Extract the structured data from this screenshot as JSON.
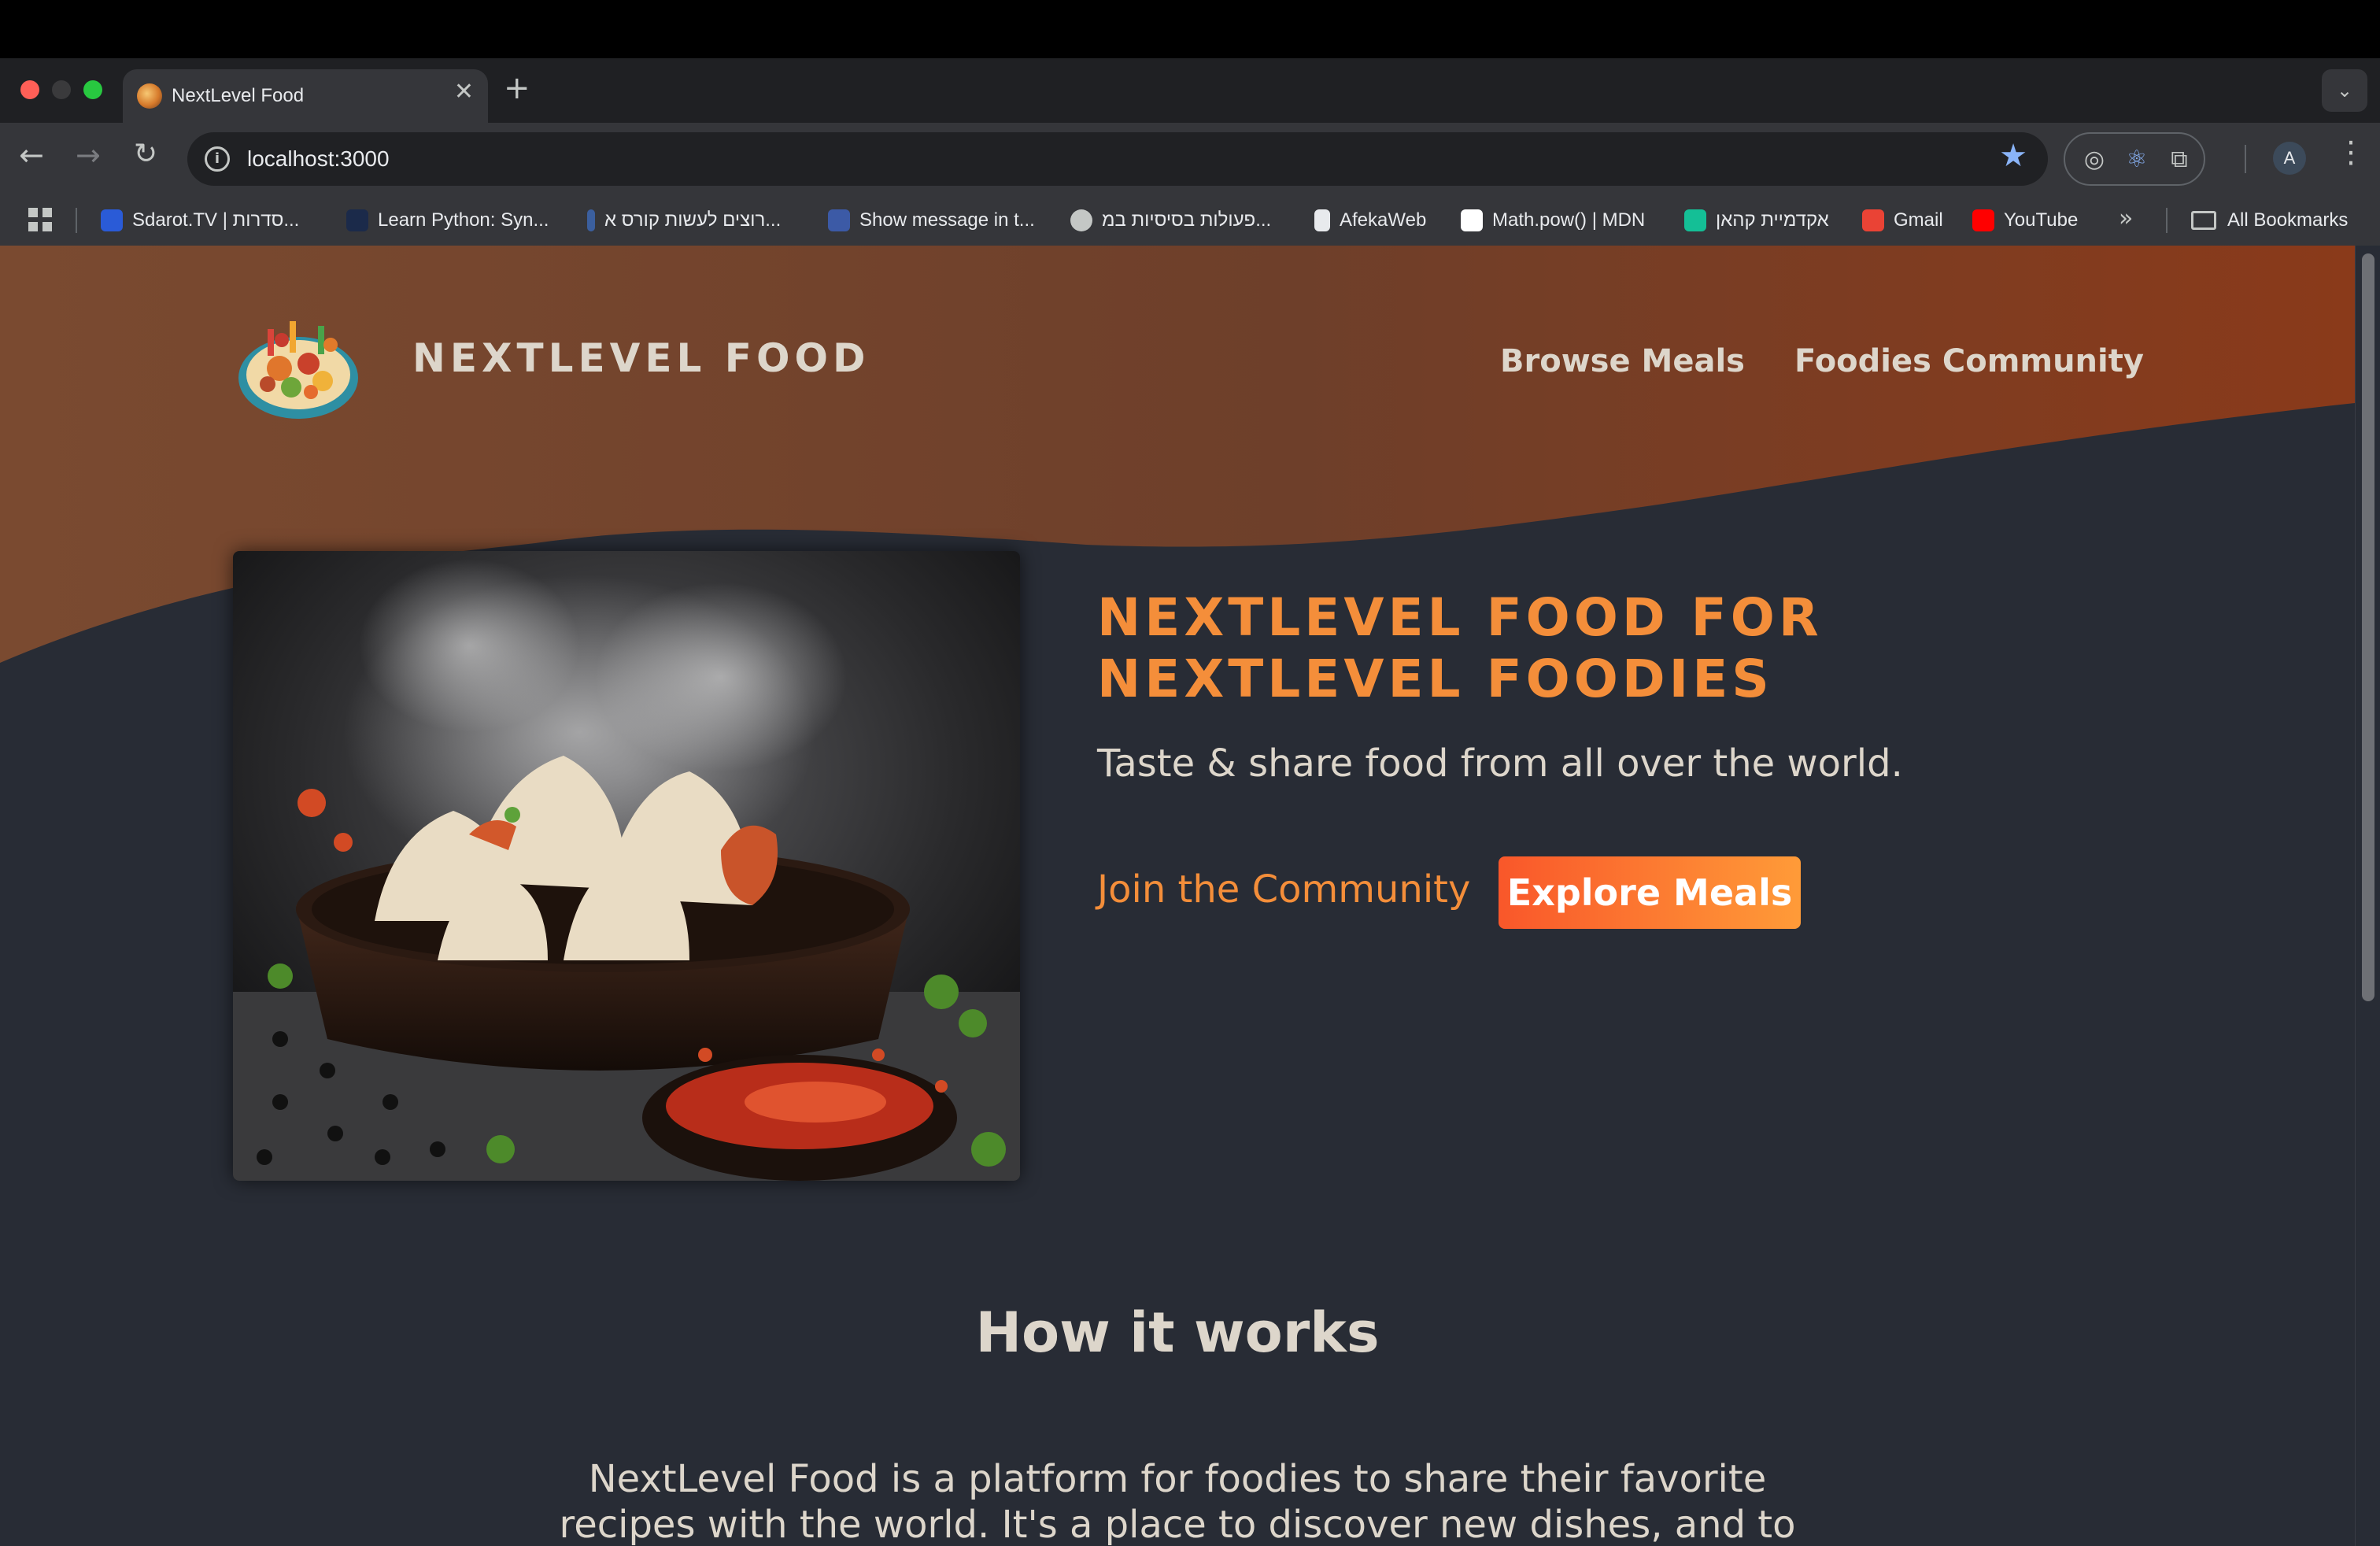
{
  "browser": {
    "tab": {
      "title": "NextLevel Food"
    },
    "new_tab_symbol": "+",
    "address": {
      "url": "localhost:3000"
    },
    "profile_initial": "A",
    "bookmarks": [
      {
        "label": "Sdarot.TV | סדרות...",
        "color": "#2a5bd7"
      },
      {
        "label": "Learn Python: Syn...",
        "color": "#1b2a4a"
      },
      {
        "label": "רוצים לעשות קורס א...",
        "color": "#3b5f9e"
      },
      {
        "label": "Show message in t...",
        "color": "#3c5aa6"
      },
      {
        "label": "פעולות בסיסיות במ...",
        "color": "#c4c7c5"
      },
      {
        "label": "AfekaWeb",
        "color": "#e8eaed"
      },
      {
        "label": "Math.pow() | MDN",
        "color": "#ffffff"
      },
      {
        "label": "אקדמיית קהאן",
        "color": "#14bf96"
      },
      {
        "label": "Gmail",
        "color": "#ea4335"
      },
      {
        "label": "YouTube",
        "color": "#ff0000"
      }
    ],
    "more_bookmarks": "»",
    "all_bookmarks": "All Bookmarks"
  },
  "page": {
    "logo_text": "NextLevel Food",
    "nav": {
      "browse": "Browse Meals",
      "community": "Foodies Community"
    },
    "hero": {
      "title": "NextLevel Food for NextLevel Foodies",
      "subtitle": "Taste & share food from all over the world.",
      "join_link": "Join the Community",
      "explore_button": "Explore Meals"
    },
    "how": {
      "title": "How it works",
      "text": "NextLevel Food is a platform for foodies to share their favorite recipes with the world. It's a place to discover new dishes, and to connect with"
    }
  },
  "colors": {
    "accent": "#f48e3a",
    "header_gradient_start": "#7a4a30",
    "header_gradient_end": "#8a3a1a",
    "page_bg": "#282c35",
    "text": "#ddd6cb"
  }
}
